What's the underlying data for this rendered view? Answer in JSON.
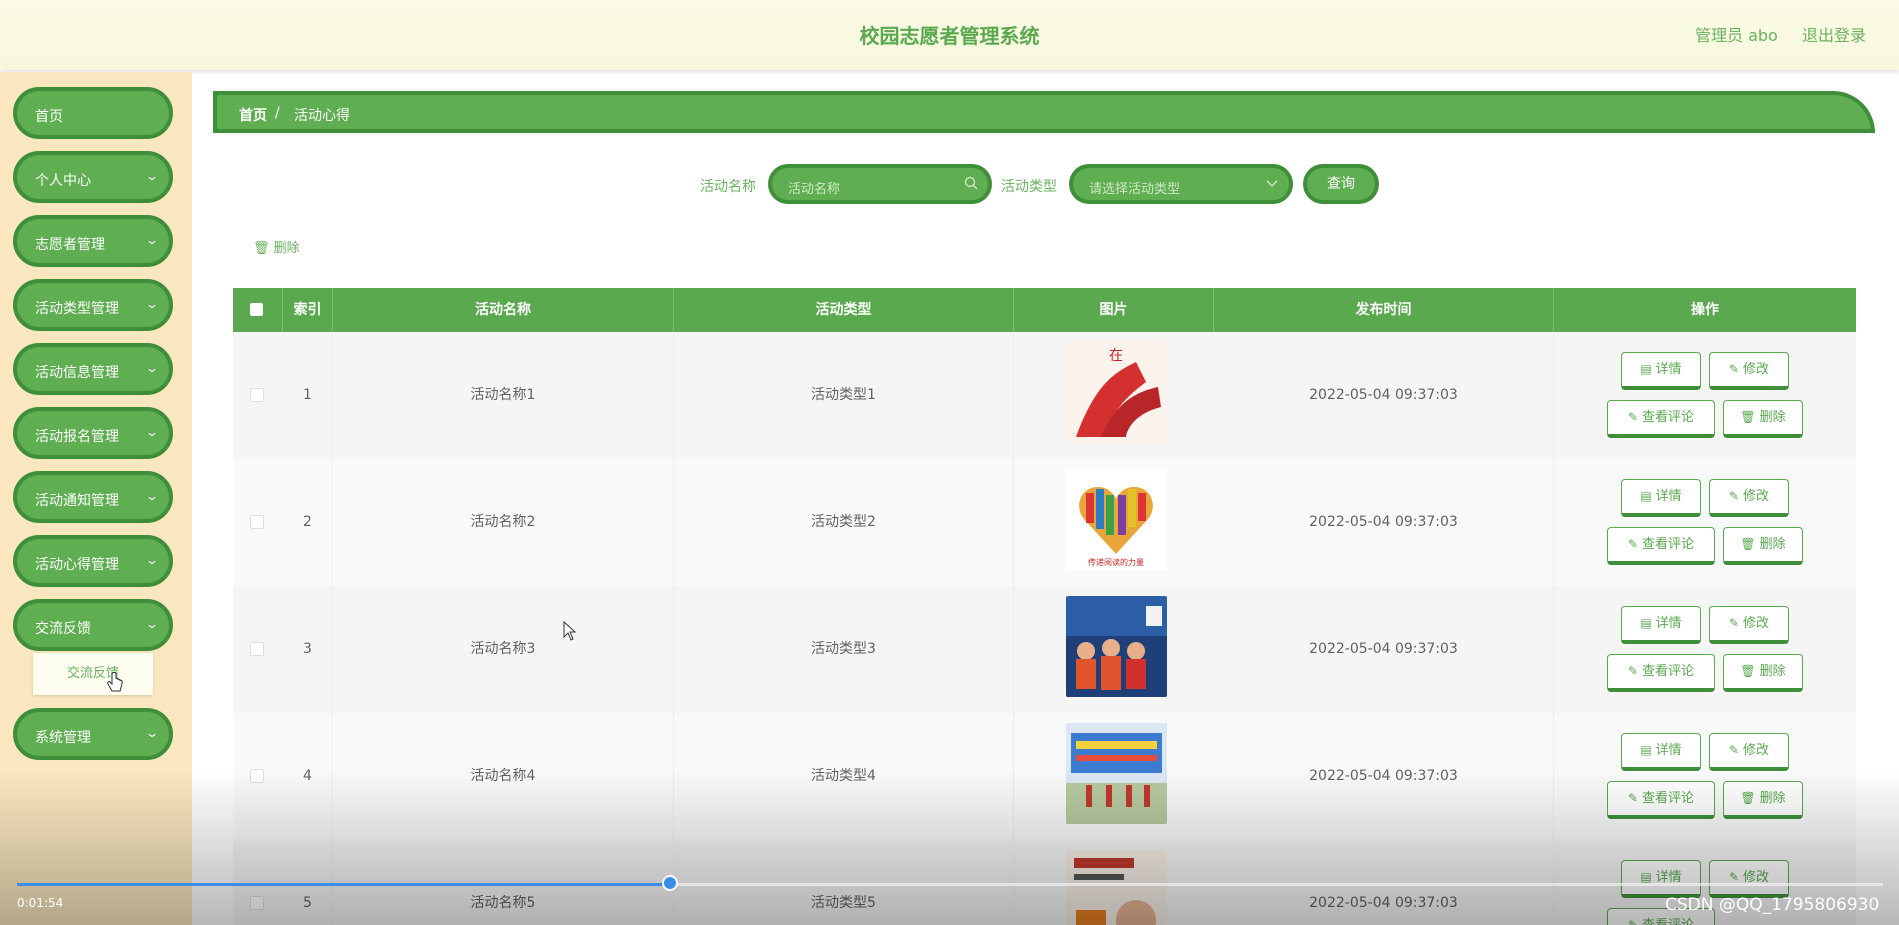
{
  "header": {
    "title": "校园志愿者管理系统",
    "admin": "管理员 abo",
    "logout": "退出登录"
  },
  "sidebar": {
    "items": [
      {
        "label": "首页",
        "chevron": false
      },
      {
        "label": "个人中心",
        "chevron": true
      },
      {
        "label": "志愿者管理",
        "chevron": true
      },
      {
        "label": "活动类型管理",
        "chevron": true
      },
      {
        "label": "活动信息管理",
        "chevron": true
      },
      {
        "label": "活动报名管理",
        "chevron": true
      },
      {
        "label": "活动通知管理",
        "chevron": true
      },
      {
        "label": "活动心得管理",
        "chevron": true
      },
      {
        "label": "交流反馈",
        "chevron": true
      },
      {
        "label": "系统管理",
        "chevron": true
      }
    ],
    "submenu": "交流反馈"
  },
  "breadcrumb": {
    "home": "首页",
    "separator": "/",
    "current": "活动心得"
  },
  "search": {
    "name_label": "活动名称",
    "name_placeholder": "活动名称",
    "type_label": "活动类型",
    "type_placeholder": "请选择活动类型",
    "query_button": "查询"
  },
  "bulk_delete": "删除",
  "table": {
    "headers": [
      "索引",
      "活动名称",
      "活动类型",
      "图片",
      "发布时间",
      "操作"
    ],
    "rows": [
      {
        "index": "1",
        "name": "活动名称1",
        "type": "活动类型1",
        "time": "2022-05-04 09:37:03"
      },
      {
        "index": "2",
        "name": "活动名称2",
        "type": "活动类型2",
        "time": "2022-05-04 09:37:03"
      },
      {
        "index": "3",
        "name": "活动名称3",
        "type": "活动类型3",
        "time": "2022-05-04 09:37:03"
      },
      {
        "index": "4",
        "name": "活动名称4",
        "type": "活动类型4",
        "time": "2022-05-04 09:37:03"
      },
      {
        "index": "5",
        "name": "活动名称5",
        "type": "活动类型5",
        "time": "2022-05-04 09:37:03"
      }
    ],
    "actions": {
      "detail": "详情",
      "edit": "修改",
      "comments": "查看评论",
      "delete": "删除"
    }
  },
  "video": {
    "time": "0:01:54",
    "progress": 0.35,
    "watermark": "CSDN @QQ_1795806930"
  },
  "colors": {
    "primary": "#5fae52",
    "border": "#3f8f3a",
    "sidebar_bg": "#fbe7bf",
    "header_bg": "#f7f8dc"
  },
  "icons": [
    "search-icon",
    "chevron-down-icon",
    "trash-icon",
    "document-icon",
    "edit-icon",
    "mouse-cursor-icon",
    "hand-cursor-icon"
  ]
}
